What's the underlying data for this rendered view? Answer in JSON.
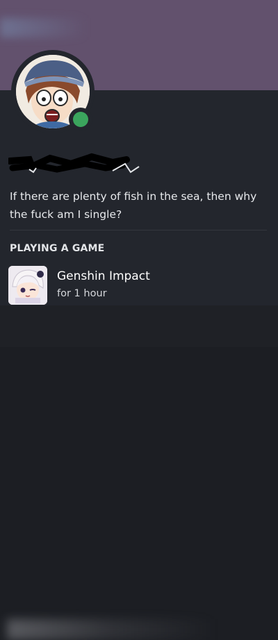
{
  "profile": {
    "banner_color": "#62516d",
    "avatar_icon": "cartoon-character-avatar",
    "status": "online",
    "status_color": "#3ba55d",
    "username": "",
    "bio_line1": "If there are plenty of fish in the sea, then why",
    "bio_line2": "the fuck am I single?"
  },
  "activity": {
    "section_title": "PLAYING A GAME",
    "game_icon": "genshin-impact-game-icon",
    "game_name": "Genshin Impact",
    "duration": "for 1 hour"
  }
}
